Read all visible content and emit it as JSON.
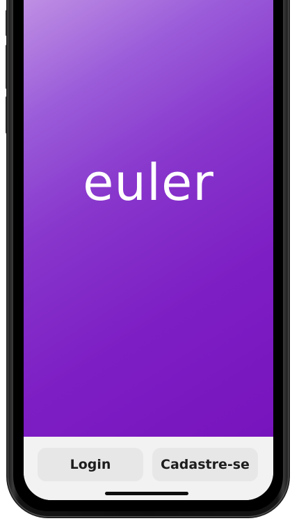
{
  "app": {
    "logo_text": "euler"
  },
  "actions": {
    "login_label": "Login",
    "signup_label": "Cadastre-se"
  },
  "theme": {
    "gradient_start": "#c79be6",
    "gradient_end": "#7814bd",
    "bar_background": "#f2f2f2",
    "button_background": "#e7e7e7",
    "button_text": "#1d1d1d"
  }
}
